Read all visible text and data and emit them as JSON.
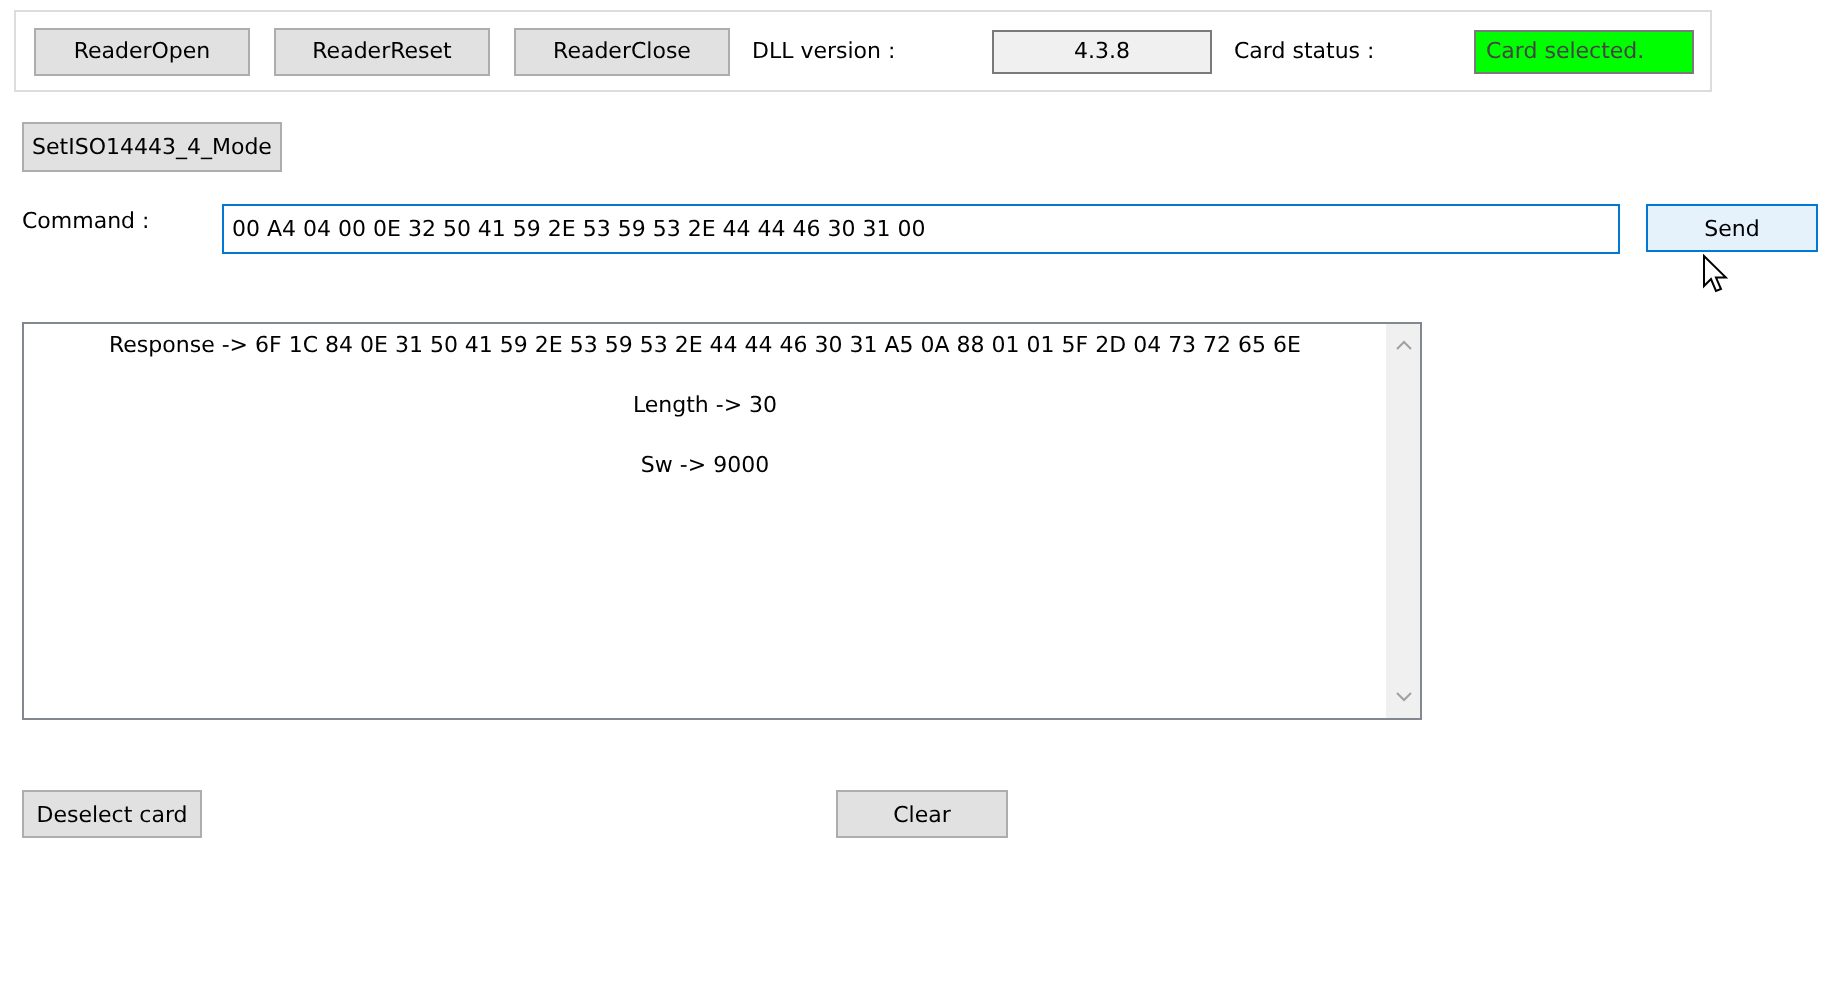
{
  "reader_buttons": [
    "ReaderOpen",
    "ReaderReset",
    "ReaderClose"
  ],
  "dll_version": {
    "label": "DLL version :",
    "value": "4.3.8"
  },
  "card_status": {
    "label": "Card status :",
    "value": "Card selected.",
    "color": "#00ff00"
  },
  "mode_button": "SetISO14443_4_Mode",
  "command": {
    "label": "Command :",
    "value": "00 A4 04 00 0E 32 50 41 59 2E 53 59 53 2E 44 44 46 30 31 00"
  },
  "send_button": {
    "label": "Send",
    "hovered": true
  },
  "response_lines": [
    "Response -> 6F 1C 84 0E 31 50 41 59 2E 53 59 53 2E 44 44 46 30 31 A5 0A 88 01 01 5F 2D 04 73 72 65 6E",
    "Length -> 30",
    "Sw -> 9000"
  ],
  "bottom_buttons": [
    "Deselect card",
    "Clear"
  ]
}
